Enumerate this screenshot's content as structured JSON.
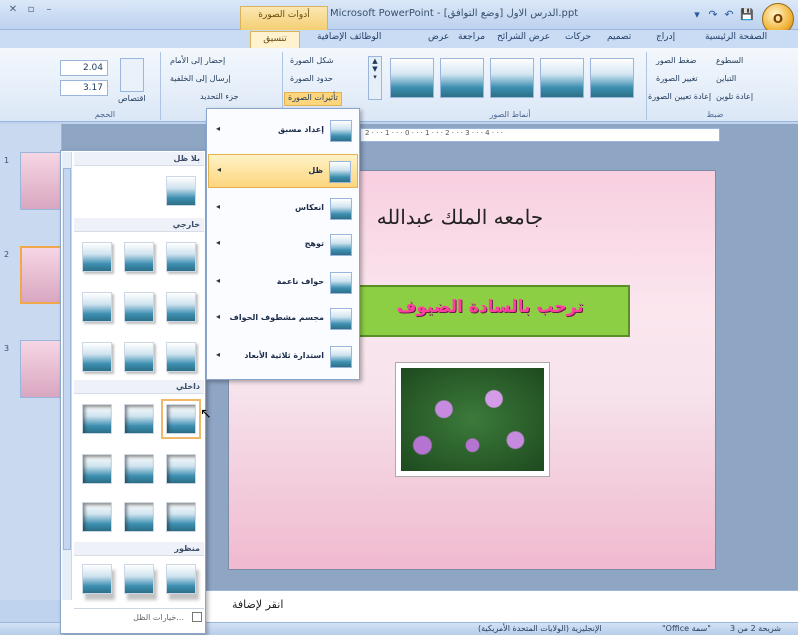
{
  "window": {
    "title": "Microsoft PowerPoint - [وضع التوافق] الدرس الاول.ppt",
    "context_tab_group": "أدوات الصورة",
    "office_button": "O",
    "qat": [
      "💾",
      "↶",
      "↷",
      "▾"
    ],
    "controls": [
      "–",
      "▫",
      "✕"
    ]
  },
  "tabs": [
    "الصفحة الرئيسية",
    "إدراج",
    "تصميم",
    "حركات",
    "عرض الشرائح",
    "مراجعة",
    "عرض",
    "الوظائف الإضافية"
  ],
  "active_tab": "تنسيق",
  "ribbon": {
    "adjust": {
      "items": [
        "السطوع",
        "التباين",
        "إعادة تلوين",
        "ضغط الصور",
        "تغيير الصورة",
        "إعادة تعيين الصورة"
      ],
      "label": "ضبط"
    },
    "styles": {
      "label": "أنماط الصور"
    },
    "shape_tools": {
      "items": [
        "شكل الصورة",
        "حدود الصورة",
        "تأثيرات الصورة"
      ]
    },
    "arrange": {
      "items": [
        "إحضار إلى الأمام",
        "إرسال إلى الخلفية",
        "جزء التحديد"
      ],
      "label": "ترتيب"
    },
    "size": {
      "height": "2.04",
      "width": "3.17",
      "crop": "اقتصاص",
      "label": "الحجم"
    }
  },
  "ruler_text": "2 · · · 1 · · · 0 · · · 1 · · · 2 · · · 3 · · · 4 · · ·",
  "slides": {
    "numbers": [
      "1",
      "2",
      "3"
    ]
  },
  "slide": {
    "title": "جامعه الملك عبدالله",
    "banner": "ترحب بالسادة الضيوف"
  },
  "notes": {
    "placeholder": "انقر لإضافة"
  },
  "status": {
    "slide_of": "شريحة 2 من 3",
    "theme": "\"Office سمة\"",
    "language": "الإنجليزية (الولايات المتحدة الأمريكية)"
  },
  "gallery": {
    "sections": [
      "بلا ظل",
      "خارجي",
      "داخلي",
      "منظور"
    ],
    "footer": "خيارات الظل..."
  },
  "effects_menu": {
    "items": [
      {
        "label": "إعداد مسبق",
        "active": false
      },
      {
        "label": "ظل",
        "active": true
      },
      {
        "label": "انعكاس",
        "active": false
      },
      {
        "label": "توهج",
        "active": false
      },
      {
        "label": "حواف ناعمة",
        "active": false
      },
      {
        "label": "مجسم مشطوف الحواف",
        "active": false
      },
      {
        "label": "استدارة ثلاثية الأبعاد",
        "active": false
      }
    ]
  }
}
